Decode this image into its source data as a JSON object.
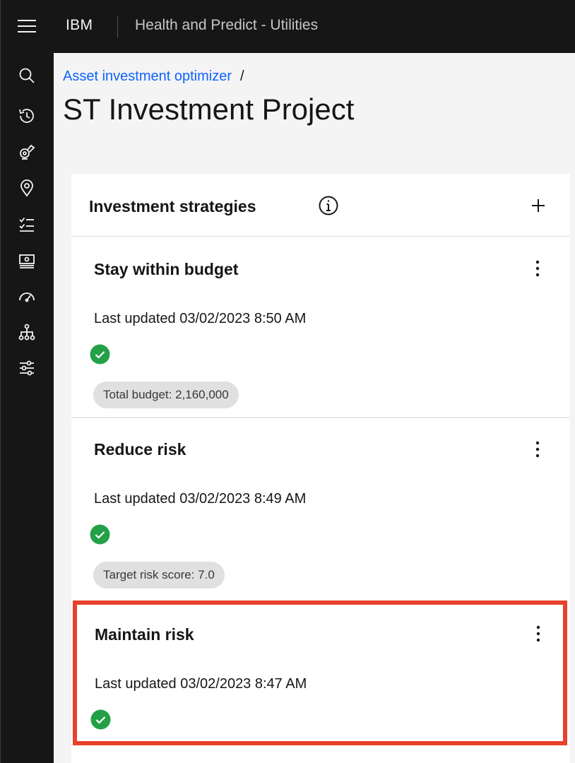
{
  "header": {
    "brand": "IBM",
    "app_title": "Health and Predict - Utilities"
  },
  "sidenav": {
    "items": [
      {
        "icon": "search-icon"
      },
      {
        "icon": "history-icon"
      },
      {
        "icon": "asset-icon"
      },
      {
        "icon": "location-icon"
      },
      {
        "icon": "checklist-icon"
      },
      {
        "icon": "money-icon"
      },
      {
        "icon": "gauge-icon"
      },
      {
        "icon": "hierarchy-icon"
      },
      {
        "icon": "settings-sliders-icon"
      }
    ]
  },
  "breadcrumb": {
    "parent": "Asset investment optimizer",
    "separator": "/"
  },
  "page": {
    "title": "ST Investment Project"
  },
  "panel": {
    "title": "Investment strategies",
    "info_icon": "information-icon",
    "add_icon": "add-icon"
  },
  "strategies": [
    {
      "name": "Stay within budget",
      "updated": "Last updated 03/02/2023 8:50 AM",
      "status": "success",
      "tag": "Total budget: 2,160,000"
    },
    {
      "name": "Reduce risk",
      "updated": "Last updated 03/02/2023 8:49 AM",
      "status": "success",
      "tag": "Target risk score: 7.0"
    },
    {
      "name": "Maintain risk",
      "updated": "Last updated 03/02/2023 8:47 AM",
      "status": "success",
      "highlighted": true
    }
  ],
  "colors": {
    "header_bg": "#161616",
    "link": "#0f62fe",
    "success": "#24a148",
    "highlight_border": "#e8412c",
    "tag_bg": "#e0e0e0"
  }
}
